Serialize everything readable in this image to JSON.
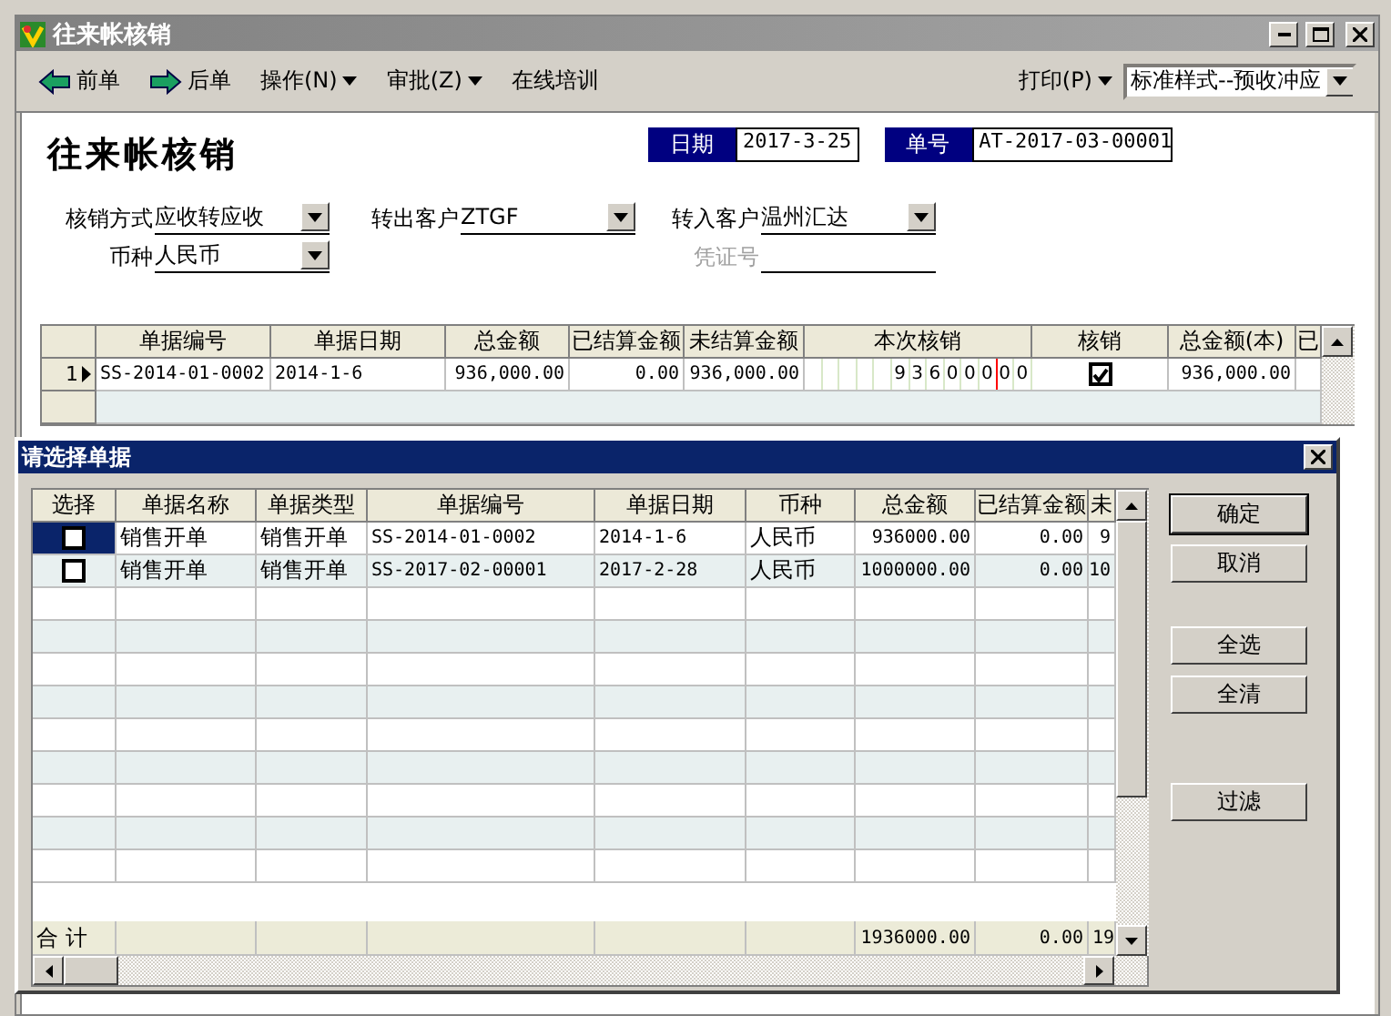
{
  "window": {
    "title": "往来帐核销"
  },
  "toolbar": {
    "items": [
      {
        "label": "前单",
        "kind": "prev"
      },
      {
        "label": "后单",
        "kind": "next"
      },
      {
        "label": "操作(N)",
        "kind": "dropdown"
      },
      {
        "label": "审批(Z)",
        "kind": "dropdown"
      },
      {
        "label": "在线培训",
        "kind": "plain"
      }
    ],
    "print": {
      "label": "打印(P)"
    },
    "style_select": {
      "value": "标准样式--预收冲应"
    }
  },
  "form": {
    "heading": "往来帐核销",
    "date": {
      "label": "日期",
      "value": "2017-3-25"
    },
    "number": {
      "label": "单号",
      "value": "AT-2017-03-00001"
    },
    "rows": [
      [
        {
          "label": "核销方式",
          "value": "应收转应收",
          "kind": "select",
          "disabled": false
        },
        {
          "label": "转出客户",
          "value": "ZTGF",
          "kind": "select",
          "disabled": false
        },
        {
          "label": "转入客户",
          "value": "温州汇达",
          "kind": "select",
          "disabled": false
        }
      ],
      [
        {
          "label": "币种",
          "value": "人民币",
          "kind": "select",
          "disabled": false
        },
        "",
        {
          "label": "凭证号",
          "kind": "text",
          "disabled": true
        }
      ]
    ]
  },
  "grid": {
    "columns": [
      "单据编号",
      "单据日期",
      "总金额",
      "已结算金额",
      "未结算金额",
      "本次核销",
      "核销",
      "总金额(本)",
      "已"
    ],
    "rows": [
      {
        "number": "1",
        "current": true,
        "doc_no": "SS-2014-01-0002",
        "date": "2014-1-6",
        "total": "936,000.00",
        "settled": "0.00",
        "unsettled": "936,000.00",
        "writeoff_digits": [
          "9",
          "3",
          "6",
          "0",
          "0",
          "0",
          "0",
          "0"
        ],
        "checked": true,
        "total_local": "936,000.00"
      }
    ]
  },
  "dialog": {
    "title": "请选择单据",
    "columns": [
      "选择",
      "单据名称",
      "单据类型",
      "单据编号",
      "单据日期",
      "币种",
      "总金额",
      "已结算金额",
      "未"
    ],
    "rows": [
      {
        "checked": false,
        "focused": true,
        "name": "销售开单",
        "type": "销售开单",
        "doc_no": "SS-2014-01-0002",
        "date": "2014-1-6",
        "currency": "人民币",
        "total": "936000.00",
        "settled": "0.00",
        "column_9": "9"
      },
      {
        "checked": false,
        "focused": false,
        "name": "销售开单",
        "type": "销售开单",
        "doc_no": "SS-2017-02-00001",
        "date": "2017-2-28",
        "currency": "人民币",
        "total": "1000000.00",
        "settled": "0.00",
        "column_9": "10"
      }
    ],
    "totals": {
      "label": "合 计",
      "total": "1936000.00",
      "settled": "0.00",
      "column_9": "19"
    },
    "button_groups": [
      [
        "确定",
        "取消"
      ],
      [
        "全选",
        "全清"
      ],
      [
        "过滤"
      ]
    ]
  }
}
